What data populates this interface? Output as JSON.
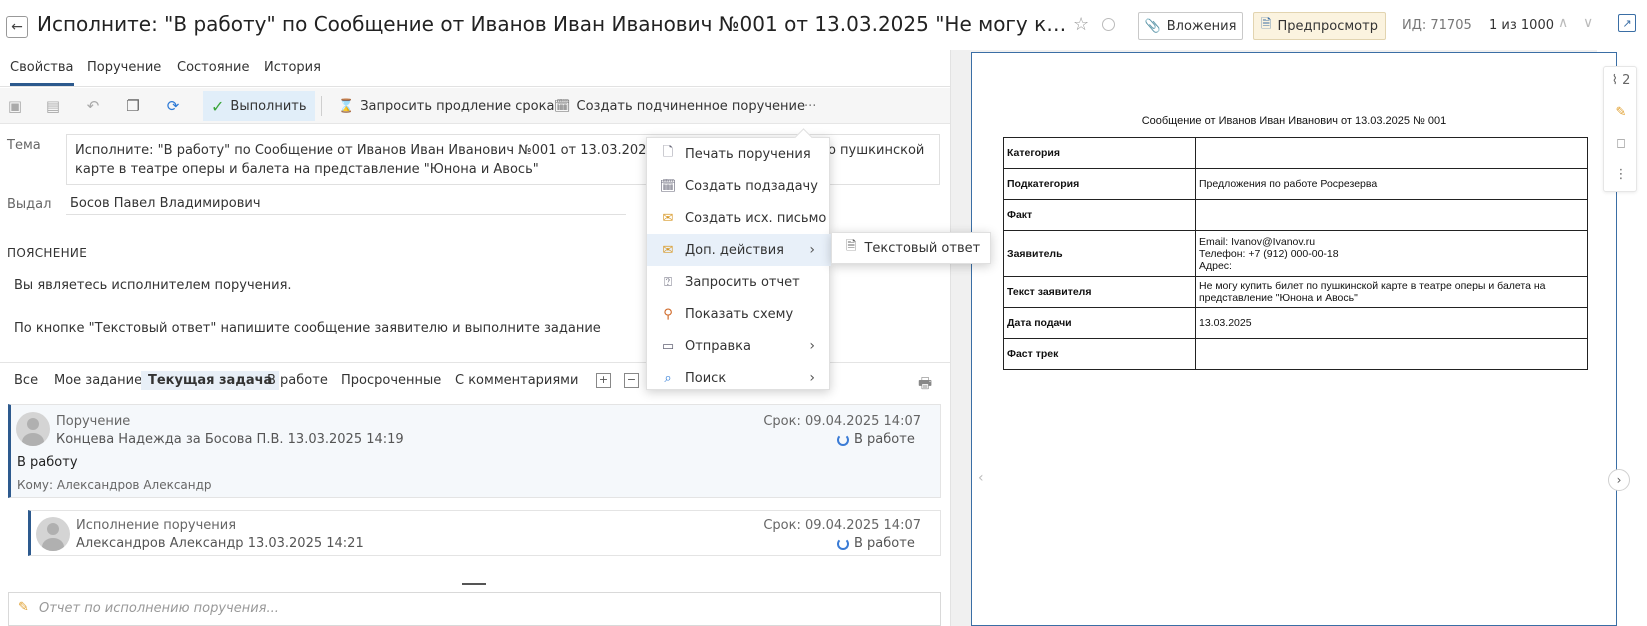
{
  "header": {
    "back_icon": "arrow-left-icon",
    "title": "Исполните: \"В работу\" по Сообщение от Иванов Иван Иванович №001 от 13.03.2025 \"Не могу купить билет п...",
    "attachments_label": "Вложения",
    "preview_label": "Предпросмотр",
    "id_text": "ИД: 71705",
    "counter_text": "1 из 1000"
  },
  "tabs": [
    "Свойства",
    "Поручение",
    "Состояние",
    "История"
  ],
  "toolbar": {
    "execute_label": "Выполнить",
    "extend_label": "Запросить продление срока",
    "subtask_label": "Создать подчиненное поручение",
    "more_label": "···"
  },
  "form": {
    "theme_label": "Тема",
    "theme_value": "Исполните: \"В работу\" по Сообщение от Иванов Иван Иванович №001 от 13.03.2025 \"Не могу купить билет по пушкинской карте в театре оперы и балета на представление \"Юнона и Авось\"",
    "issuer_label": "Выдал",
    "issuer_value": "Босов Павел Владимирович",
    "explanation_header": "ПОЯСНЕНИЕ",
    "explanation_line1": "Вы являетесь исполнителем поручения.",
    "explanation_line2": "По кнопке \"Текстовый ответ\" напишите сообщение заявителю и выполните задание"
  },
  "filters": [
    "Все",
    "Мое задание",
    "Текущая задача",
    "В работе",
    "Просроченные",
    "С комментариями"
  ],
  "cards": [
    {
      "type": "Поручение",
      "who": "Концева Надежда за Босова П.В.  13.03.2025 14:19",
      "due": "Срок: 09.04.2025 14:07",
      "status": "В работе",
      "body": "В работу",
      "to": "Кому: Александров Александр"
    },
    {
      "type": "Исполнение поручения",
      "who": "Александров Александр  13.03.2025 14:21",
      "due": "Срок: 09.04.2025 14:07",
      "status": "В работе"
    }
  ],
  "report_placeholder": "Отчет по исполнению поручения...",
  "menu": {
    "items": [
      {
        "label": "Печать поручения",
        "icon": "print-doc-icon"
      },
      {
        "label": "Создать подзадачу",
        "icon": "subtask-icon"
      },
      {
        "label": "Создать исх. письмо",
        "icon": "outgoing-mail-icon"
      },
      {
        "label": "Доп. действия",
        "icon": "extra-actions-icon"
      },
      {
        "label": "Запросить отчет",
        "icon": "request-report-icon"
      },
      {
        "label": "Показать схему",
        "icon": "scheme-icon"
      },
      {
        "label": "Отправка",
        "icon": "send-icon"
      },
      {
        "label": "Поиск",
        "icon": "search-icon"
      }
    ],
    "submenu_label": "Текстовый ответ"
  },
  "document": {
    "title": "Сообщение от Иванов Иван Иванович от 13.03.2025 № 001",
    "rows": [
      {
        "key": "Категория",
        "value": ""
      },
      {
        "key": "Подкатегория",
        "value": "Предложения по работе Росрезерва"
      },
      {
        "key": "Факт",
        "value": ""
      },
      {
        "key": "Заявитель",
        "value": "Email: Ivanov@Ivanov.ru\nТелефон: +7 (912) 000-00-18\nАдрес:"
      },
      {
        "key": "Текст заявителя",
        "value": "Не могу купить билет по пушкинской карте в театре оперы и балета на представление \"Юнона и Авось\""
      },
      {
        "key": "Дата подачи",
        "value": "13.03.2025"
      },
      {
        "key": "Фаст трек",
        "value": ""
      }
    ]
  },
  "sidebar": {
    "attachments_count": "2"
  },
  "colors": {
    "accent": "#2d5a8e",
    "execute_bg": "#e1eef9",
    "preview_bg": "#fbf3df",
    "menu_highlight": "#e8f0f9"
  }
}
